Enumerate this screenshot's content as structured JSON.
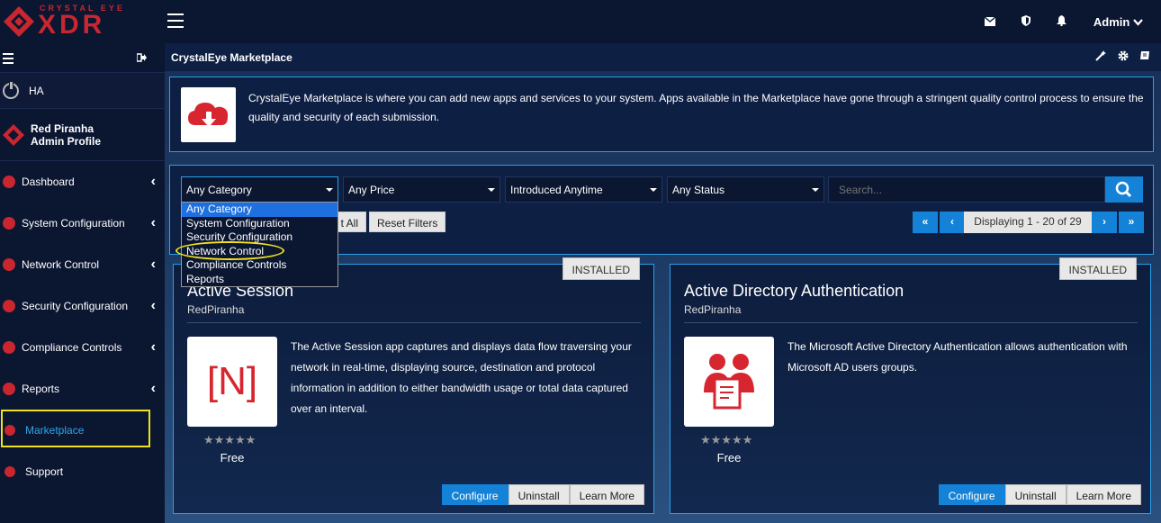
{
  "brand": {
    "top": "CRYSTAL EYE",
    "main": "XDR"
  },
  "header": {
    "user": "Admin"
  },
  "sidebar": {
    "ha": "HA",
    "profile": {
      "name": "Red Piranha",
      "role": "Admin Profile"
    },
    "items": [
      {
        "label": "Dashboard"
      },
      {
        "label": "System Configuration"
      },
      {
        "label": "Network Control"
      },
      {
        "label": "Security Configuration"
      },
      {
        "label": "Compliance Controls"
      },
      {
        "label": "Reports"
      },
      {
        "label": "Marketplace"
      },
      {
        "label": "Support"
      }
    ]
  },
  "page": {
    "title": "CrystalEye Marketplace"
  },
  "info": {
    "text": "CrystalEye Marketplace is where you can add new apps and services to your system. Apps available in the Marketplace have gone through a stringent quality control process to ensure the quality and security of each submission."
  },
  "filters": {
    "category": "Any Category",
    "price": "Any Price",
    "introduced": "Introduced Anytime",
    "status": "Any Status",
    "search_placeholder": "Search...",
    "select_all_partial": "t All",
    "reset": "Reset Filters",
    "pager": {
      "first": "«",
      "prev": "‹",
      "info": "Displaying 1 - 20 of 29",
      "next": "›",
      "last": "»"
    },
    "category_options": [
      "Any Category",
      "System Configuration",
      "Security Configuration",
      "Network Control",
      "Compliance Controls",
      "Reports"
    ]
  },
  "cards": [
    {
      "badge": "INSTALLED",
      "title": "Active Session",
      "author": "RedPiranha",
      "logo_text": "[N]",
      "description": "The Active Session app captures and displays data flow traversing your network in real-time, displaying source, destination and protocol information in addition to either bandwidth usage or total data captured over an interval.",
      "stars": "★★★★★",
      "price": "Free",
      "configure": "Configure",
      "uninstall": "Uninstall",
      "learn_more": "Learn More"
    },
    {
      "badge": "INSTALLED",
      "title": "Active Directory Authentication",
      "author": "RedPiranha",
      "description": "The Microsoft Active Directory Authentication allows authentication with Microsoft AD users groups.",
      "stars": "★★★★★",
      "price": "Free",
      "configure": "Configure",
      "uninstall": "Uninstall",
      "learn_more": "Learn More"
    }
  ],
  "colors": {
    "accent": "#1482d6",
    "brand_red": "#c9262f",
    "highlight": "#f2e21c"
  }
}
